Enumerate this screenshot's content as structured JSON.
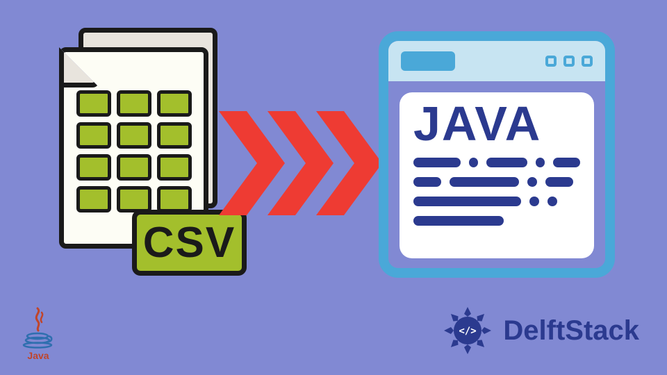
{
  "illustration": {
    "csv_tag_label": "CSV",
    "java_window_label": "JAVA",
    "arrow_color": "#ee3b33",
    "csv_cell_color": "#a3bf2c",
    "java_accent": "#4aa8d8",
    "java_text_color": "#2b3a8f"
  },
  "logos": {
    "java": {
      "name": "Java",
      "icon": "java-cup"
    },
    "delftstack": {
      "name": "DelftStack",
      "icon": "delftstack-badge"
    }
  }
}
